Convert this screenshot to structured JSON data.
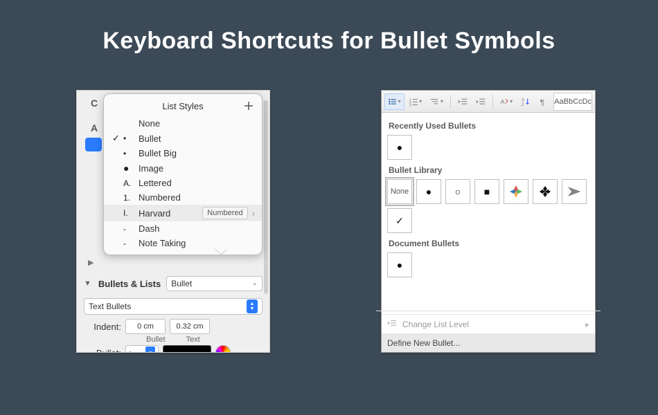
{
  "page": {
    "title": "Keyboard Shortcuts for Bullet Symbols"
  },
  "mac": {
    "popover_title": "List Styles",
    "styles": [
      {
        "checked": false,
        "mark": "",
        "label": "None"
      },
      {
        "checked": true,
        "mark": "•",
        "label": "Bullet"
      },
      {
        "checked": false,
        "mark": "•",
        "label": "Bullet Big"
      },
      {
        "checked": false,
        "mark": "●",
        "label": "Image"
      },
      {
        "checked": false,
        "mark": "A.",
        "label": "Lettered"
      },
      {
        "checked": false,
        "mark": "1.",
        "label": "Numbered"
      },
      {
        "checked": false,
        "mark": "I.",
        "label": "Harvard",
        "badge": "Numbered"
      },
      {
        "checked": false,
        "mark": "-",
        "label": "Dash"
      },
      {
        "checked": false,
        "mark": "-",
        "label": "Note Taking"
      }
    ],
    "section_title": "Bullets & Lists",
    "current_style": "Bullet",
    "bullet_type": "Text Bullets",
    "indent_label": "Indent:",
    "indent_bullet": "0 cm",
    "indent_text": "0.32 cm",
    "sub_bullet": "Bullet",
    "sub_text": "Text",
    "bullet_label": "Bullet:",
    "bullet_char": "•"
  },
  "word": {
    "style_preview": "AaBbCcDc",
    "recent_title": "Recently Used Bullets",
    "recent": [
      {
        "glyph": "●"
      }
    ],
    "library_title": "Bullet Library",
    "library": [
      {
        "none": true,
        "label": "None"
      },
      {
        "glyph": "●"
      },
      {
        "glyph": "○"
      },
      {
        "glyph": "■"
      },
      {
        "color4": true
      },
      {
        "diamond4": true
      },
      {
        "arrow": true
      },
      {
        "glyph": "✓"
      }
    ],
    "doc_title": "Document Bullets",
    "doc": [
      {
        "glyph": "●"
      }
    ],
    "change_level": "Change List Level",
    "define_new": "Define New Bullet..."
  }
}
